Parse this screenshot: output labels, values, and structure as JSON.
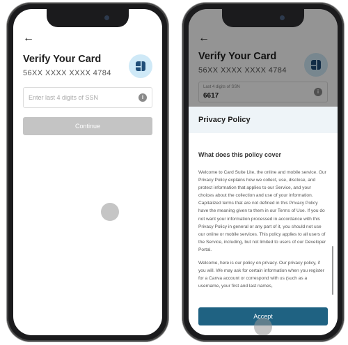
{
  "left_screen": {
    "title": "Verify Your Card",
    "card_number": "56XX XXXX XXXX 4784",
    "ssn_placeholder": "Enter last 4 digits of SSN",
    "continue_label": "Continue"
  },
  "right_screen": {
    "title": "Verify Your Card",
    "card_number": "56XX XXXX XXXX 4784",
    "ssn_label": "Last 4 digits of SSN",
    "ssn_value": "6617",
    "privacy": {
      "title": "Privacy Policy",
      "heading": "What does this policy cover",
      "paragraph_1": "Welcome to Card Suite Lite, the online and mobile service. Our Privacy Policy explains how we collect, use, disclose, and protect information that applies to our Service, and your choices about the collection and use of your information. Capitalized terms that are not defined in this Privacy Policy have the meaning given to them in our Terms of Use. If you do not want your information processed in accordance with this Privacy Policy in general or any part of it, you should not use our online or mobile services. This policy applies to all users of the Service, including, but not limited to users of our Developer Portal.",
      "paragraph_2": "Welcome, here is our policy on privacy. Our privacy policy, if you will. We may ask for certain information when you register for a Canva account or correspond with us (such as a username, your first and last names,",
      "accept_label": "Accept"
    }
  },
  "colors": {
    "accent": "#1f6282",
    "badge": "#cfe9f7",
    "disabled_button": "#c4c4c4"
  }
}
